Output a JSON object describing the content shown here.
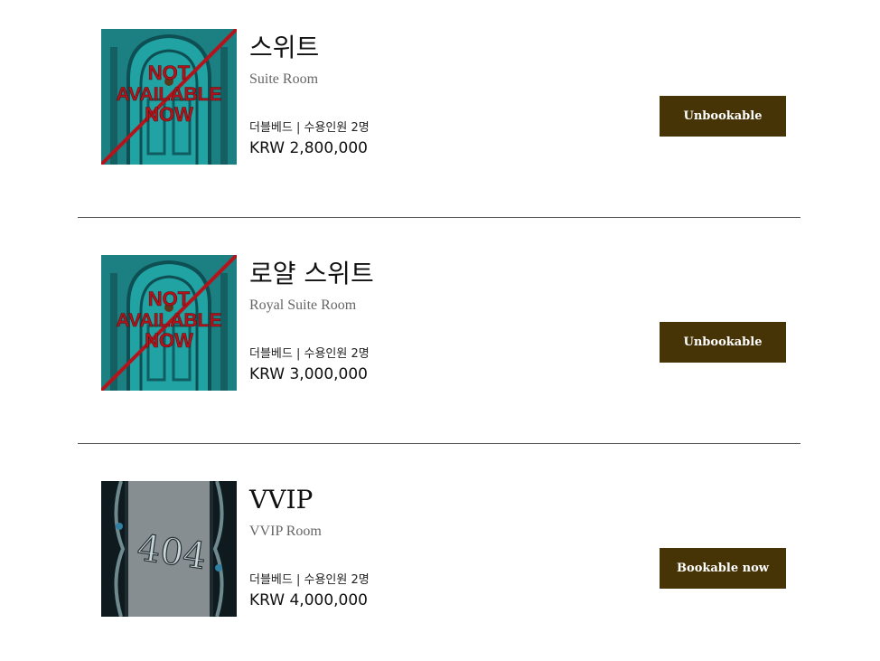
{
  "rooms": [
    {
      "title": "스위트",
      "subtitle": "Suite Room",
      "meta": "더블베드 | 수용인원 2명",
      "price": "KRW 2,800,000",
      "button_label": "Unbookable",
      "image": "not-available-door",
      "image_text": [
        "NOT",
        "AVAILABLE",
        "NOW"
      ]
    },
    {
      "title": "로얄 스위트",
      "subtitle": "Royal Suite Room",
      "meta": "더블베드 | 수용인원 2명",
      "price": "KRW 3,000,000",
      "button_label": "Unbookable",
      "image": "not-available-door",
      "image_text": [
        "NOT",
        "AVAILABLE",
        "NOW"
      ]
    },
    {
      "title": "VVIP",
      "subtitle": "VVIP Room",
      "meta": "더블베드 | 수용인원 2명",
      "price": "KRW 4,000,000",
      "button_label": "Bookable now",
      "image": "room-404-plaque",
      "image_text": [
        "404"
      ]
    }
  ],
  "colors": {
    "button_bg": "#473406",
    "button_text": "#ffffff",
    "divider": "#555555",
    "door_teal": "#1f8a8c",
    "stamp_red": "#b3141b"
  }
}
